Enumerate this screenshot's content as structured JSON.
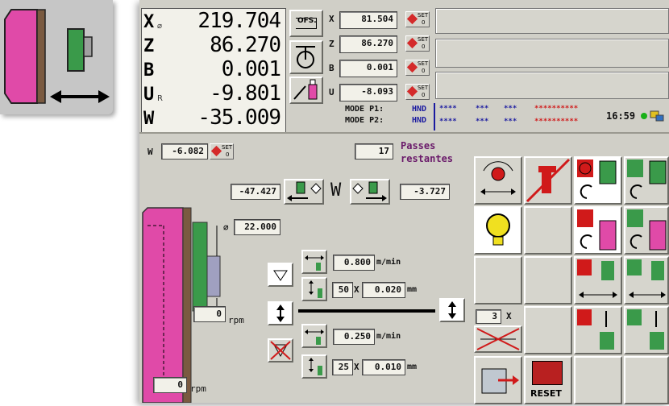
{
  "colors": {
    "panel_bg": "#d0cfc7",
    "workpiece_pink": "#e04aa8",
    "tool_green": "#3a9a4a",
    "set_red": "#d42a2a",
    "mode_blue": "#1a1aa0",
    "mode_red": "#d01a1a",
    "status_green": "#18b018"
  },
  "axes": [
    {
      "letter": "X",
      "sub": "⌀",
      "value": "219.704"
    },
    {
      "letter": "Z",
      "sub": "",
      "value": "86.270"
    },
    {
      "letter": "B",
      "sub": "",
      "value": "0.001"
    },
    {
      "letter": "U",
      "sub": "R",
      "value": "-9.801"
    },
    {
      "letter": "W",
      "sub": "",
      "value": "-35.009"
    }
  ],
  "ofs_button": "OFS.",
  "set_fields": [
    {
      "axis": "X",
      "value": "81.504"
    },
    {
      "axis": "Z",
      "value": "86.270"
    },
    {
      "axis": "B",
      "value": "0.001"
    },
    {
      "axis": "U",
      "value": "-8.093"
    }
  ],
  "set_label": "SET",
  "set_zero": "0",
  "mode": {
    "p1_label": "MODE P1:",
    "p2_label": "MODE P2:",
    "p1_value": "HND",
    "p2_value": "HND",
    "p1_stars": [
      "****",
      "***",
      "***",
      "**********"
    ],
    "p2_stars": [
      "****",
      "***",
      "***",
      "**********"
    ]
  },
  "clock": "16:59",
  "w_field": {
    "label": "W",
    "value": "-6.082"
  },
  "passes": {
    "value": "17",
    "label_line1": "Passes",
    "label_line2": "restantes"
  },
  "w_center": "W",
  "w_left_value": "-47.427",
  "w_right_value": "-3.727",
  "diameter": {
    "symbol": "⌀",
    "value": "22.000"
  },
  "rpm_upper": {
    "value": "0",
    "unit": "rpm"
  },
  "rpm_lower": {
    "value": "0",
    "unit": "rpm"
  },
  "feed_upper": {
    "value": "0.800",
    "unit": "m/min"
  },
  "step_upper": {
    "count": "50",
    "x": "X",
    "value": "0.020",
    "unit": "mm"
  },
  "feed_lower": {
    "value": "0.250",
    "unit": "m/min"
  },
  "step_lower": {
    "count": "25",
    "x": "X",
    "value": "0.010",
    "unit": "mm"
  },
  "counter": {
    "value": "3",
    "x": "X"
  },
  "reset_label": "RESET"
}
